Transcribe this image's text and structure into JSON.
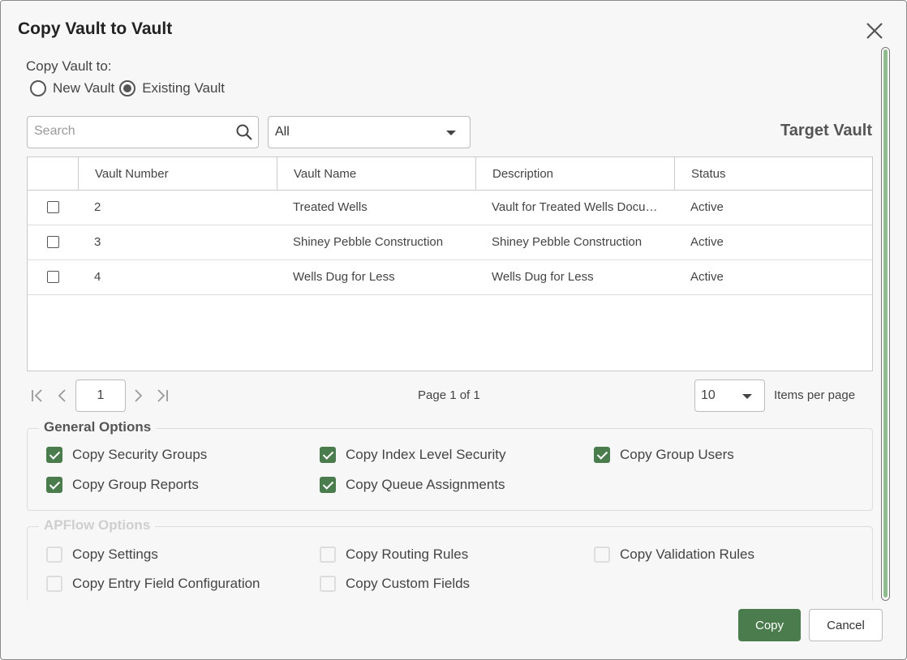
{
  "dialog": {
    "title": "Copy Vault to Vault",
    "close_icon": "close-icon"
  },
  "copy_to": {
    "label": "Copy Vault to:",
    "options": [
      {
        "label": "New Vault",
        "selected": false
      },
      {
        "label": "Existing Vault",
        "selected": true
      }
    ]
  },
  "filters": {
    "search_placeholder": "Search",
    "search_value": "",
    "status_filter": "All"
  },
  "target_label": "Target Vault",
  "table": {
    "columns": [
      "Vault Number",
      "Vault Name",
      "Description",
      "Status"
    ],
    "rows": [
      {
        "number": "2",
        "name": "Treated Wells",
        "description": "Vault for Treated Wells Documents",
        "status": "Active",
        "checked": false
      },
      {
        "number": "3",
        "name": "Shiney Pebble Construction",
        "description": "Shiney Pebble Construction",
        "status": "Active",
        "checked": false
      },
      {
        "number": "4",
        "name": "Wells Dug for Less",
        "description": "Wells Dug for Less",
        "status": "Active",
        "checked": false
      }
    ]
  },
  "pager": {
    "current_page": "1",
    "page_info": "Page 1 of 1",
    "page_size": "10",
    "items_per_page_label": "Items per page"
  },
  "general_options": {
    "legend": "General Options",
    "items": [
      {
        "label": "Copy Security Groups",
        "checked": true
      },
      {
        "label": "Copy Index Level Security",
        "checked": true
      },
      {
        "label": "Copy Group Users",
        "checked": true
      },
      {
        "label": "Copy Group Reports",
        "checked": true
      },
      {
        "label": "Copy Queue Assignments",
        "checked": true
      }
    ]
  },
  "apflow_options": {
    "legend": "APFlow Options",
    "items": [
      {
        "label": "Copy Settings",
        "checked": false
      },
      {
        "label": "Copy Routing Rules",
        "checked": false
      },
      {
        "label": "Copy Validation Rules",
        "checked": false
      },
      {
        "label": "Copy Entry Field Configuration",
        "checked": false
      },
      {
        "label": "Copy Custom Fields",
        "checked": false
      }
    ]
  },
  "buttons": {
    "copy": "Copy",
    "cancel": "Cancel"
  },
  "colors": {
    "accent": "#4a7c4e",
    "scroll_thumb": "#8fbc8f"
  }
}
